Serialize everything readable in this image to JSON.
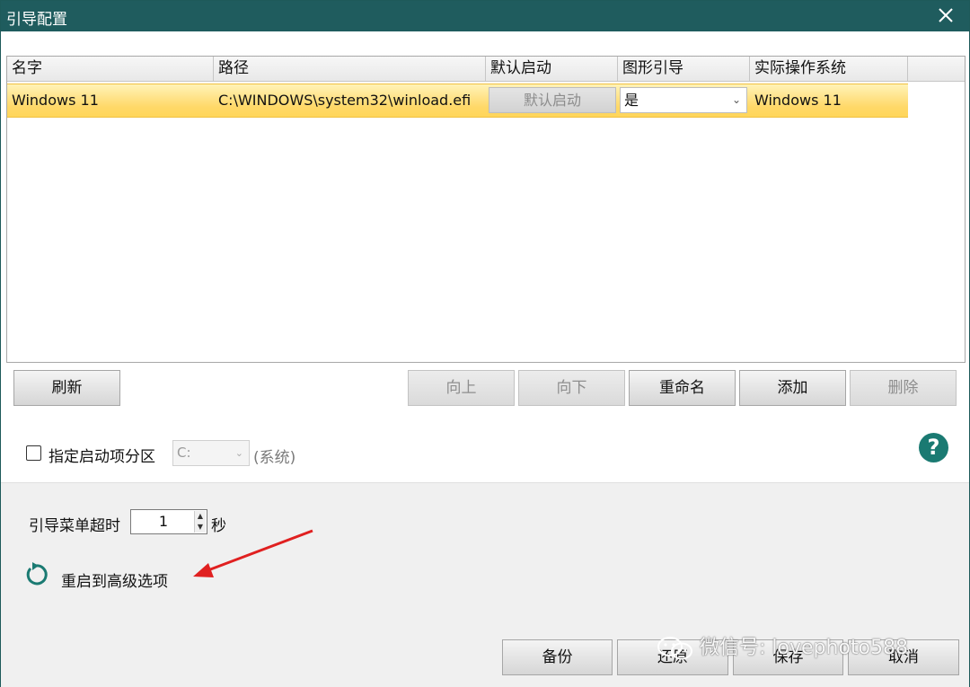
{
  "window": {
    "title": "引导配置"
  },
  "table": {
    "columns": [
      "名字",
      "路径",
      "默认启动",
      "图形引导",
      "实际操作系统"
    ],
    "rows": [
      {
        "name": "Windows 11",
        "path": "C:\\WINDOWS\\system32\\winload.efi",
        "default_button": "默认启动",
        "graphic": "是",
        "os": "Windows 11"
      }
    ]
  },
  "actions": {
    "refresh": "刷新",
    "up": "向上",
    "down": "向下",
    "rename": "重命名",
    "add": "添加",
    "delete": "删除"
  },
  "partition": {
    "checkbox_label": "指定启动项分区",
    "selected": "C:",
    "suffix": "(系统)"
  },
  "timeout": {
    "label": "引导菜单超时",
    "value": "1",
    "unit": "秒"
  },
  "advanced": {
    "label": "重启到高级选项"
  },
  "footer": {
    "backup": "备份",
    "restore": "还原",
    "save": "保存",
    "cancel": "取消"
  },
  "watermark": "微信号: lovephoto588",
  "colors": {
    "titlebar": "#1f5c5e",
    "accent": "#1a7a72",
    "selected_row": "#ffd868",
    "arrow": "#e02020"
  }
}
